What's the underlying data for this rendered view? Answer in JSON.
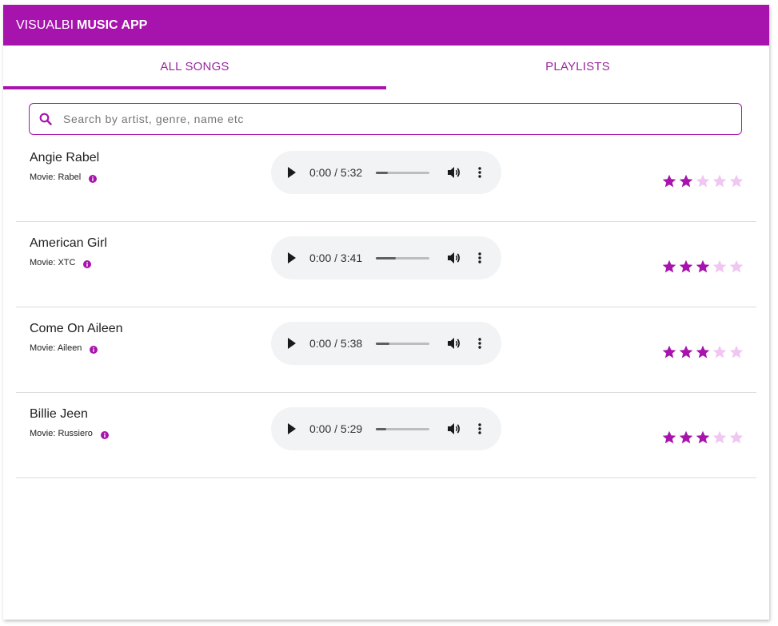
{
  "app": {
    "brand": "VISUALBI",
    "title": "MUSIC APP"
  },
  "tabs": [
    {
      "label": "ALL SONGS",
      "active": true
    },
    {
      "label": "PLAYLISTS",
      "active": false
    }
  ],
  "search": {
    "placeholder": "Search by artist, genre, name etc",
    "value": ""
  },
  "colors": {
    "accent": "#a714ad",
    "star_filled": "#a714ad",
    "star_empty": "#f1c6f3"
  },
  "songs": [
    {
      "name": "Angie Rabel",
      "movie": "Movie: Rabel",
      "time": "0:00 / 5:32",
      "progress": 0.22,
      "rating": 2
    },
    {
      "name": "American Girl",
      "movie": "Movie: XTC",
      "time": "0:00 / 3:41",
      "progress": 0.37,
      "rating": 3
    },
    {
      "name": "Come On Aileen",
      "movie": "Movie: Aileen",
      "time": "0:00 / 5:38",
      "progress": 0.25,
      "rating": 3
    },
    {
      "name": "Billie Jeen",
      "movie": "Movie: Russiero",
      "time": "0:00 / 5:29",
      "progress": 0.2,
      "rating": 3
    }
  ],
  "icons": {
    "search": "search-icon",
    "info": "info-icon",
    "play": "play-icon",
    "volume": "volume-icon",
    "more": "more-vert-icon",
    "star": "star-icon"
  },
  "max_rating": 5
}
